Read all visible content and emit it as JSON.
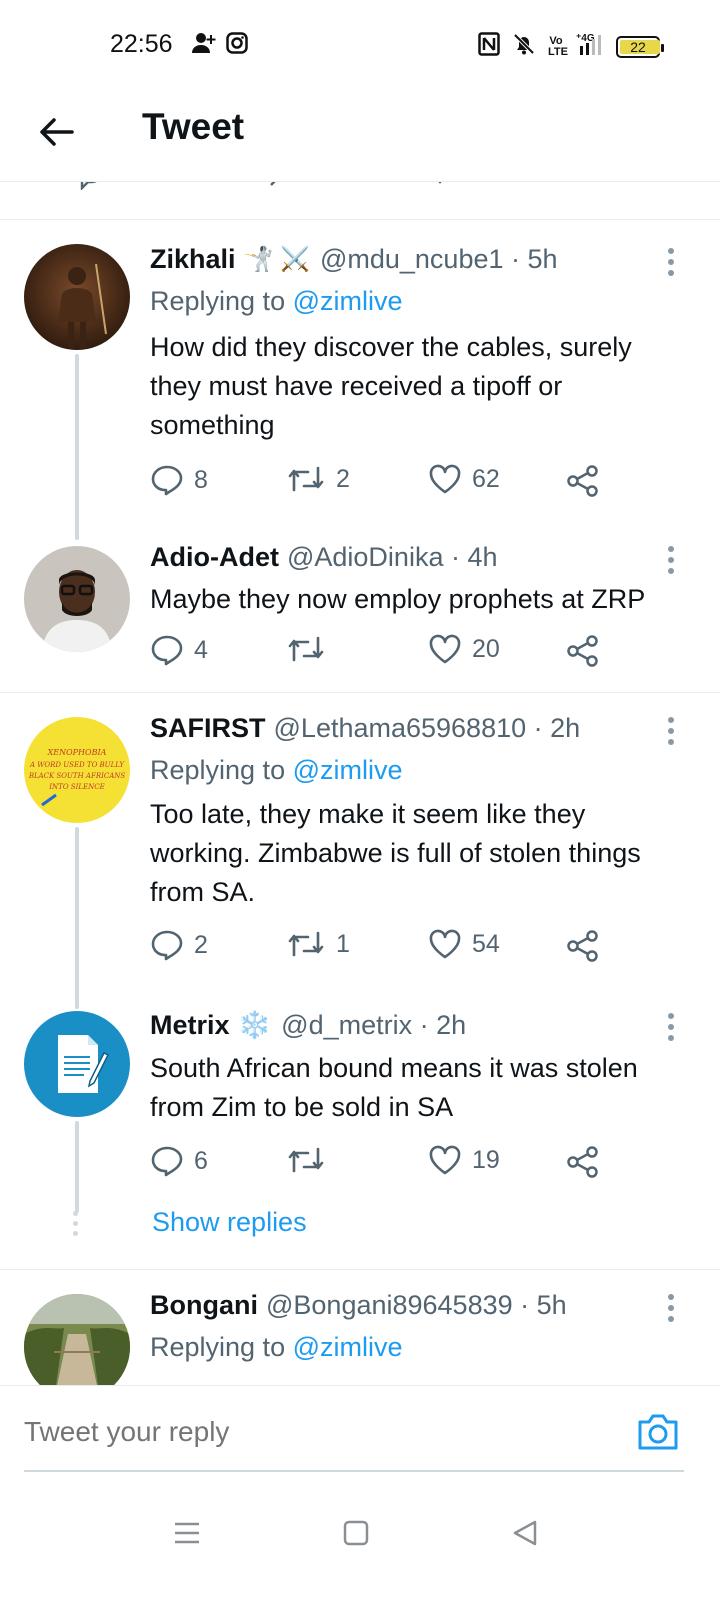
{
  "status": {
    "time": "22:56",
    "battery": "22",
    "battery_level": 0.22,
    "network": "4G",
    "volte": "Vo LTE"
  },
  "header": {
    "title": "Tweet"
  },
  "tweets": [
    {
      "name": "Zikhali",
      "emoji": "🤺 ⚔️",
      "handle": "@mdu_ncube1 · 5h",
      "replying_label": "Replying to",
      "replying_to": "@zimlive",
      "text": "How did they discover the cables, surely they must have received a tipoff or something",
      "replies": "8",
      "retweets": "2",
      "likes": "62"
    },
    {
      "name": "Adio-Adet",
      "handle": "@AdioDinika · 4h",
      "text": "Maybe they now employ prophets at ZRP",
      "replies": "4",
      "retweets": "",
      "likes": "20"
    },
    {
      "name": "SAFIRST",
      "handle": "@Lethama65968810 · 2h",
      "replying_label": "Replying to",
      "replying_to": "@zimlive",
      "text": "Too late, they make it seem like they working. Zimbabwe is full of stolen things from SA.",
      "replies": "2",
      "retweets": "1",
      "likes": "54",
      "avatar_text": [
        "XENOPHOBIA",
        "A WORD USED TO BULLY",
        "BLACK SOUTH AFRICANS",
        "INTO SILENCE"
      ]
    },
    {
      "name": "Metrix",
      "emoji": "❄️",
      "handle": "@d_metrix · 2h",
      "text": "South African bound means it was stolen from Zim to be sold in SA",
      "replies": "6",
      "retweets": "",
      "likes": "19"
    },
    {
      "name": "Bongani",
      "handle": "@Bongani89645839 · 5h",
      "replying_label": "Replying to",
      "replying_to": "@zimlive"
    }
  ],
  "show_replies": "Show replies",
  "reply_bar": {
    "placeholder": "Tweet your reply"
  },
  "colors": {
    "accent": "#1d9bf0",
    "text": "#0f1419",
    "muted": "#536471",
    "divider": "#e6ecf0"
  }
}
